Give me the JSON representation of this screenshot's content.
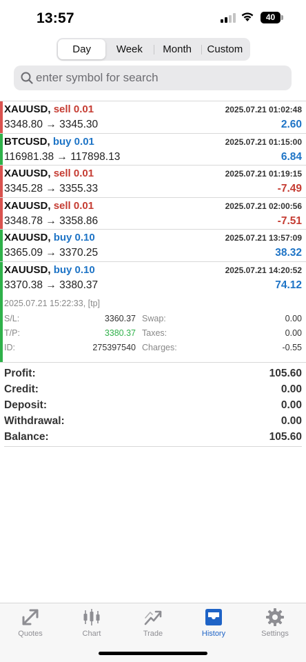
{
  "status": {
    "time": "13:57",
    "battery": "40"
  },
  "period_tabs": [
    {
      "label": "Day",
      "active": true
    },
    {
      "label": "Week",
      "active": false
    },
    {
      "label": "Month",
      "active": false
    },
    {
      "label": "Custom",
      "active": false
    }
  ],
  "search": {
    "placeholder": "enter symbol for search",
    "value": ""
  },
  "deals": [
    {
      "symbol": "XAUUSD,",
      "direction": "sell 0.01",
      "type": "sell",
      "time": "2025.07.21 01:02:48",
      "prices": "3348.80 → 3345.30",
      "profit": "2.60",
      "sign": "pos"
    },
    {
      "symbol": "BTCUSD,",
      "direction": "buy 0.01",
      "type": "buy",
      "time": "2025.07.21 01:15:00",
      "prices": "116981.38 → 117898.13",
      "profit": "6.84",
      "sign": "pos"
    },
    {
      "symbol": "XAUUSD,",
      "direction": "sell 0.01",
      "type": "sell",
      "time": "2025.07.21 01:19:15",
      "prices": "3345.28 → 3355.33",
      "profit": "-7.49",
      "sign": "neg"
    },
    {
      "symbol": "XAUUSD,",
      "direction": "sell 0.01",
      "type": "sell",
      "time": "2025.07.21 02:00:56",
      "prices": "3348.78 → 3358.86",
      "profit": "-7.51",
      "sign": "neg"
    },
    {
      "symbol": "XAUUSD,",
      "direction": "buy 0.10",
      "type": "buy",
      "time": "2025.07.21 13:57:09",
      "prices": "3365.09 → 3370.25",
      "profit": "38.32",
      "sign": "pos"
    }
  ],
  "expanded_deal": {
    "symbol": "XAUUSD,",
    "direction": "buy 0.10",
    "type": "buy",
    "time": "2025.07.21 14:20:52",
    "prices": "3370.38 → 3380.37",
    "profit": "74.12",
    "close_info": "2025.07.21 15:22:33, [tp]",
    "sl_label": "S/L:",
    "sl": "3360.37",
    "tp_label": "T/P:",
    "tp": "3380.37",
    "id_label": "ID:",
    "id": "275397540",
    "swap_label": "Swap:",
    "swap": "0.00",
    "taxes_label": "Taxes:",
    "taxes": "0.00",
    "charges_label": "Charges:",
    "charges": "-0.55"
  },
  "summary": [
    {
      "label": "Profit:",
      "value": "105.60"
    },
    {
      "label": "Credit:",
      "value": "0.00"
    },
    {
      "label": "Deposit:",
      "value": "0.00"
    },
    {
      "label": "Withdrawal:",
      "value": "0.00"
    },
    {
      "label": "Balance:",
      "value": "105.60"
    }
  ],
  "tabs": [
    {
      "label": "Quotes",
      "icon": "quotes-icon"
    },
    {
      "label": "Chart",
      "icon": "chart-icon"
    },
    {
      "label": "Trade",
      "icon": "trade-icon"
    },
    {
      "label": "History",
      "icon": "history-icon",
      "active": true
    },
    {
      "label": "Settings",
      "icon": "settings-icon"
    }
  ],
  "colors": {
    "buy": "#1e74c6",
    "sell": "#c53c32",
    "accent": "#1e63c6",
    "buy_bar": "#2fb14a",
    "sell_bar": "#d9534f"
  }
}
